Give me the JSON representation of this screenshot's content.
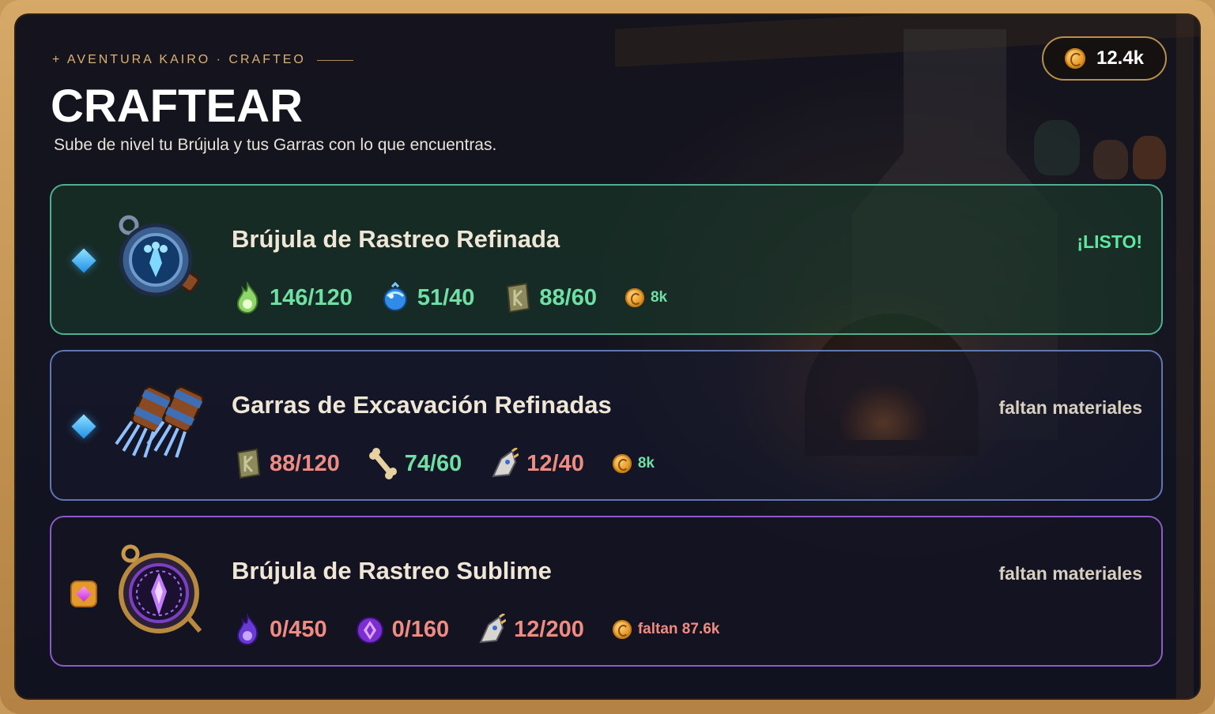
{
  "header": {
    "eyebrow": "+ AVENTURA KAIRO · CRAFTEO",
    "title": "CRAFTEAR",
    "subtitle": "Sube de nivel tu Brújula y tus Garras con lo que encuentras."
  },
  "wallet": {
    "coins": "12.4k",
    "icon": "gold-coin-icon"
  },
  "recipes": [
    {
      "name": "Brújula de Rastreo Refinada",
      "status": "¡LISTO!",
      "tier": "blue",
      "border_color": "#4fb090",
      "materials": [
        {
          "icon": "green-flame-icon",
          "amount": "146/120",
          "enough": true
        },
        {
          "icon": "blue-orb-icon",
          "amount": "51/40",
          "enough": true
        },
        {
          "icon": "rune-stone-icon",
          "amount": "88/60",
          "enough": true
        }
      ],
      "cost": "8k",
      "cost_enough": true
    },
    {
      "name": "Garras de Excavación Refinadas",
      "status": "faltan materiales",
      "tier": "blue",
      "border_color": "#6076b0",
      "materials": [
        {
          "icon": "rune-stone-icon",
          "amount": "88/120",
          "enough": false
        },
        {
          "icon": "bone-icon",
          "amount": "74/60",
          "enough": true
        },
        {
          "icon": "beast-skull-icon",
          "amount": "12/40",
          "enough": false
        }
      ],
      "cost": "8k",
      "cost_enough": true
    },
    {
      "name": "Brújula de Rastreo Sublime",
      "status": "faltan materiales",
      "tier": "gold",
      "border_color": "#8d5ac8",
      "materials": [
        {
          "icon": "purple-flame-icon",
          "amount": "0/450",
          "enough": false
        },
        {
          "icon": "purple-gem-icon",
          "amount": "0/160",
          "enough": false
        },
        {
          "icon": "beast-skull-icon",
          "amount": "12/200",
          "enough": false
        }
      ],
      "cost": "faltan 87.6k",
      "cost_enough": false
    }
  ],
  "colors": {
    "frame": "#c79a5c",
    "ready": "#5fe6a0",
    "enough": "#6fe0a3",
    "missing": "#f08b82",
    "accent_gold": "#d9b277"
  }
}
